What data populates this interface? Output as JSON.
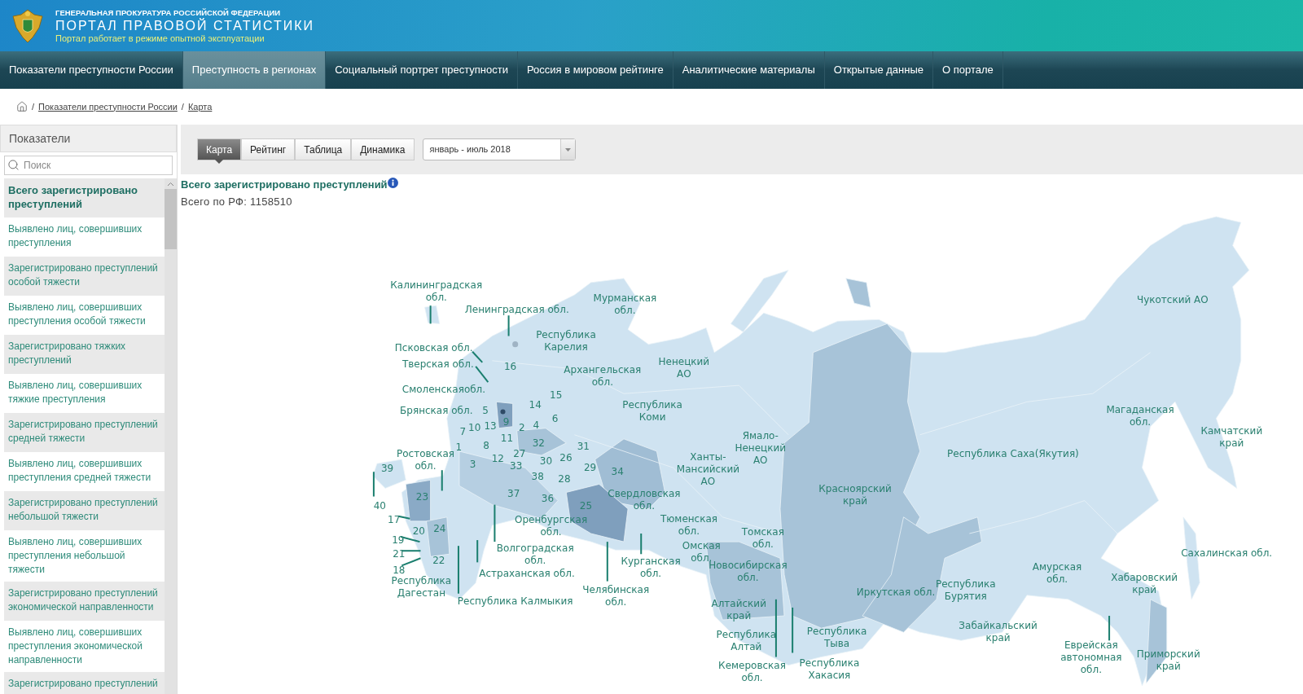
{
  "header": {
    "agency": "ГЕНЕРАЛЬНАЯ ПРОКУРАТУРА РОССИЙСКОЙ ФЕДЕРАЦИИ",
    "title": "ПОРТАЛ ПРАВОВОЙ СТАТИСТИКИ",
    "notice": "Портал работает в режиме опытной эксплуатации"
  },
  "nav": [
    {
      "label": "Показатели преступности России",
      "selected": false
    },
    {
      "label": "Преступность в регионах",
      "selected": true
    },
    {
      "label": "Социальный портрет преступности",
      "selected": false
    },
    {
      "label": "Россия в мировом рейтинге",
      "selected": false
    },
    {
      "label": "Аналитические материалы",
      "selected": false
    },
    {
      "label": "Открытые данные",
      "selected": false
    },
    {
      "label": "О портале",
      "selected": false
    }
  ],
  "breadcrumb": {
    "separator": "/",
    "links": [
      "Показатели преступности России",
      "Карта"
    ]
  },
  "sidebar": {
    "title": "Показатели",
    "search": {
      "placeholder": "Поиск"
    },
    "items": [
      {
        "label": "Всего зарегистрировано преступлений",
        "selected": true
      },
      {
        "label": "Выявлено лиц, совершивших преступления",
        "selected": false
      },
      {
        "label": "Зарегистрировано преступлений особой тяжести",
        "selected": false
      },
      {
        "label": "Выявлено лиц, совершивших преступления особой тяжести",
        "selected": false
      },
      {
        "label": "Зарегистрировано тяжких преступлений",
        "selected": false
      },
      {
        "label": "Выявлено лиц, совершивших тяжкие преступления",
        "selected": false
      },
      {
        "label": "Зарегистрировано преступлений средней тяжести",
        "selected": false
      },
      {
        "label": "Выявлено лиц, совершивших преступления средней тяжести",
        "selected": false
      },
      {
        "label": "Зарегистрировано преступлений небольшой тяжести",
        "selected": false
      },
      {
        "label": "Выявлено лиц, совершивших преступления небольшой тяжести",
        "selected": false
      },
      {
        "label": "Зарегистрировано преступлений экономической направленности",
        "selected": false
      },
      {
        "label": "Выявлено лиц, совершивших преступления экономической направленности",
        "selected": false
      },
      {
        "label": "Зарегистрировано преступлений",
        "selected": false
      }
    ]
  },
  "view_tabs": [
    {
      "label": "Карта",
      "selected": true
    },
    {
      "label": "Рейтинг",
      "selected": false
    },
    {
      "label": "Таблица",
      "selected": false
    },
    {
      "label": "Динамика",
      "selected": false
    }
  ],
  "period_select": {
    "value": "январь - июль 2018"
  },
  "indicator": {
    "title": "Всего зарегистрировано преступлений",
    "total": "Всего по РФ: 1158510"
  },
  "map": {
    "region_labels": [
      {
        "lines": [
          "Калининградская",
          "обл."
        ]
      },
      {
        "lines": [
          "Ленинградская обл."
        ]
      },
      {
        "lines": [
          "Мурманская",
          "обл."
        ]
      },
      {
        "lines": [
          "Псковская обл."
        ]
      },
      {
        "lines": [
          "Республика",
          "Карелия"
        ]
      },
      {
        "lines": [
          "Тверская обл."
        ]
      },
      {
        "lines": [
          "Смоленскаяобл."
        ]
      },
      {
        "lines": [
          "Брянская обл."
        ]
      },
      {
        "lines": [
          "Архангельская",
          "обл."
        ]
      },
      {
        "lines": [
          "Ненецкий",
          "АО"
        ]
      },
      {
        "lines": [
          "Республика",
          "Коми"
        ]
      },
      {
        "lines": [
          "Ростовская",
          "обл."
        ]
      },
      {
        "lines": [
          "Ханты-",
          "Мансийский",
          "АО"
        ]
      },
      {
        "lines": [
          "Ямало-",
          "Ненецкий",
          "АО"
        ]
      },
      {
        "lines": [
          "Свердловская",
          "обл."
        ]
      },
      {
        "lines": [
          "Красноярский",
          "край"
        ]
      },
      {
        "lines": [
          "Республика Саха(Якутия)"
        ]
      },
      {
        "lines": [
          "Оренбургская",
          "обл."
        ]
      },
      {
        "lines": [
          "Тюменская",
          "обл."
        ]
      },
      {
        "lines": [
          "Волгоградская",
          "обл."
        ]
      },
      {
        "lines": [
          "Республика",
          "Дагестан"
        ]
      },
      {
        "lines": [
          "Астраханская обл."
        ]
      },
      {
        "lines": [
          "Курганская",
          "обл."
        ]
      },
      {
        "lines": [
          "Омская",
          "обл."
        ]
      },
      {
        "lines": [
          "Томская",
          "обл."
        ]
      },
      {
        "lines": [
          "Новосибирская",
          "обл."
        ]
      },
      {
        "lines": [
          "Республика Калмыкия"
        ]
      },
      {
        "lines": [
          "Челябинская",
          "обл."
        ]
      },
      {
        "lines": [
          "Алтайский",
          "край"
        ]
      },
      {
        "lines": [
          "Республика",
          "Алтай"
        ]
      },
      {
        "lines": [
          "Кемеровская",
          "обл."
        ]
      },
      {
        "lines": [
          "Республика",
          "Тыва"
        ]
      },
      {
        "lines": [
          "Республика",
          "Хакасия"
        ]
      },
      {
        "lines": [
          "Иркутская обл."
        ]
      },
      {
        "lines": [
          "Республика",
          "Бурятия"
        ]
      },
      {
        "lines": [
          "Забайкальский",
          "край"
        ]
      },
      {
        "lines": [
          "Амурская",
          "обл."
        ]
      },
      {
        "lines": [
          "Магаданская",
          "обл."
        ]
      },
      {
        "lines": [
          "Чукотский АО"
        ]
      },
      {
        "lines": [
          "Камчатский",
          "край"
        ]
      },
      {
        "lines": [
          "Сахалинская обл."
        ]
      },
      {
        "lines": [
          "Хабаровский",
          "край"
        ]
      },
      {
        "lines": [
          "Еврейская",
          "автономная",
          "обл."
        ]
      },
      {
        "lines": [
          "Приморский",
          "край"
        ]
      }
    ],
    "region_numbers": [
      "16",
      "5",
      "14",
      "15",
      "7",
      "10",
      "13",
      "9",
      "2",
      "4",
      "6",
      "1",
      "8",
      "11",
      "32",
      "31",
      "39",
      "3",
      "12",
      "27",
      "33",
      "30",
      "26",
      "29",
      "34",
      "38",
      "28",
      "40",
      "23",
      "37",
      "36",
      "25",
      "17",
      "20",
      "24",
      "19",
      "21",
      "18",
      "22"
    ]
  }
}
